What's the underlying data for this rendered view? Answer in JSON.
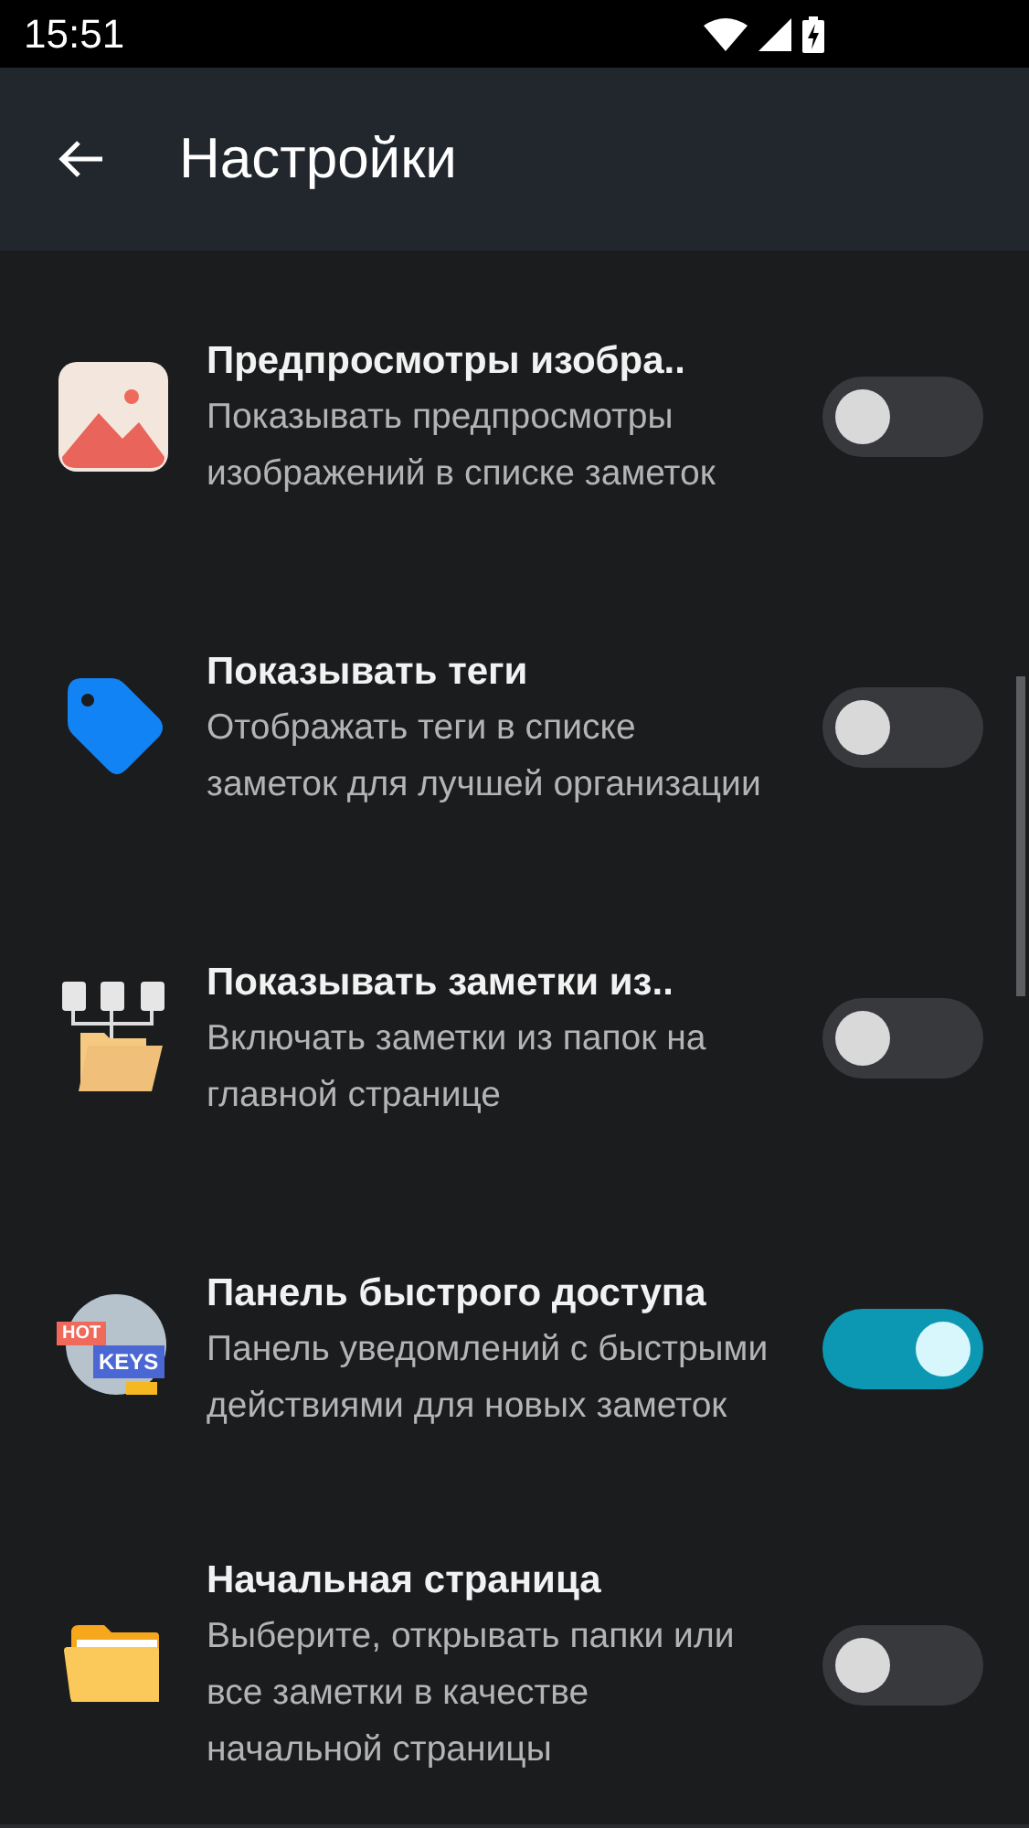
{
  "status_bar": {
    "time": "15:51"
  },
  "app_bar": {
    "title": "Настройки"
  },
  "settings": [
    {
      "kind": "image",
      "title": "Предпросмотры изобра..",
      "description": "Показывать предпросмотры изображений в списке заметок",
      "on": false
    },
    {
      "kind": "tag",
      "title": "Показывать теги",
      "description": "Отображать теги в списке заметок для лучшей организации",
      "on": false
    },
    {
      "kind": "folders",
      "title": "Показывать заметки из..",
      "description": "Включать заметки из папок на главной странице",
      "on": false
    },
    {
      "kind": "hotkeys",
      "title": "Панель быстрого доступа",
      "description": "Панель уведомлений с быстрыми действиями для новых заметок",
      "on": true,
      "icon_texts": [
        "HOT",
        "KEYS"
      ]
    },
    {
      "kind": "folder",
      "title": "Начальная страница",
      "description": "Выберите, открывать папки или все заметки в качестве начальной страницы",
      "on": false
    }
  ]
}
